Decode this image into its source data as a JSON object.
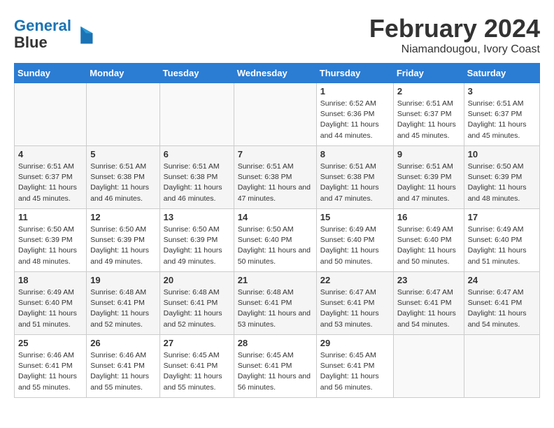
{
  "header": {
    "logo_line1": "General",
    "logo_line2": "Blue",
    "month_title": "February 2024",
    "subtitle": "Niamandougou, Ivory Coast"
  },
  "days_of_week": [
    "Sunday",
    "Monday",
    "Tuesday",
    "Wednesday",
    "Thursday",
    "Friday",
    "Saturday"
  ],
  "weeks": [
    [
      {
        "day": "",
        "sunrise": "",
        "sunset": "",
        "daylight": "",
        "empty": true
      },
      {
        "day": "",
        "sunrise": "",
        "sunset": "",
        "daylight": "",
        "empty": true
      },
      {
        "day": "",
        "sunrise": "",
        "sunset": "",
        "daylight": "",
        "empty": true
      },
      {
        "day": "",
        "sunrise": "",
        "sunset": "",
        "daylight": "",
        "empty": true
      },
      {
        "day": "1",
        "sunrise": "Sunrise: 6:52 AM",
        "sunset": "Sunset: 6:36 PM",
        "daylight": "Daylight: 11 hours and 44 minutes.",
        "empty": false
      },
      {
        "day": "2",
        "sunrise": "Sunrise: 6:51 AM",
        "sunset": "Sunset: 6:37 PM",
        "daylight": "Daylight: 11 hours and 45 minutes.",
        "empty": false
      },
      {
        "day": "3",
        "sunrise": "Sunrise: 6:51 AM",
        "sunset": "Sunset: 6:37 PM",
        "daylight": "Daylight: 11 hours and 45 minutes.",
        "empty": false
      }
    ],
    [
      {
        "day": "4",
        "sunrise": "Sunrise: 6:51 AM",
        "sunset": "Sunset: 6:37 PM",
        "daylight": "Daylight: 11 hours and 45 minutes.",
        "empty": false
      },
      {
        "day": "5",
        "sunrise": "Sunrise: 6:51 AM",
        "sunset": "Sunset: 6:38 PM",
        "daylight": "Daylight: 11 hours and 46 minutes.",
        "empty": false
      },
      {
        "day": "6",
        "sunrise": "Sunrise: 6:51 AM",
        "sunset": "Sunset: 6:38 PM",
        "daylight": "Daylight: 11 hours and 46 minutes.",
        "empty": false
      },
      {
        "day": "7",
        "sunrise": "Sunrise: 6:51 AM",
        "sunset": "Sunset: 6:38 PM",
        "daylight": "Daylight: 11 hours and 47 minutes.",
        "empty": false
      },
      {
        "day": "8",
        "sunrise": "Sunrise: 6:51 AM",
        "sunset": "Sunset: 6:38 PM",
        "daylight": "Daylight: 11 hours and 47 minutes.",
        "empty": false
      },
      {
        "day": "9",
        "sunrise": "Sunrise: 6:51 AM",
        "sunset": "Sunset: 6:39 PM",
        "daylight": "Daylight: 11 hours and 47 minutes.",
        "empty": false
      },
      {
        "day": "10",
        "sunrise": "Sunrise: 6:50 AM",
        "sunset": "Sunset: 6:39 PM",
        "daylight": "Daylight: 11 hours and 48 minutes.",
        "empty": false
      }
    ],
    [
      {
        "day": "11",
        "sunrise": "Sunrise: 6:50 AM",
        "sunset": "Sunset: 6:39 PM",
        "daylight": "Daylight: 11 hours and 48 minutes.",
        "empty": false
      },
      {
        "day": "12",
        "sunrise": "Sunrise: 6:50 AM",
        "sunset": "Sunset: 6:39 PM",
        "daylight": "Daylight: 11 hours and 49 minutes.",
        "empty": false
      },
      {
        "day": "13",
        "sunrise": "Sunrise: 6:50 AM",
        "sunset": "Sunset: 6:39 PM",
        "daylight": "Daylight: 11 hours and 49 minutes.",
        "empty": false
      },
      {
        "day": "14",
        "sunrise": "Sunrise: 6:50 AM",
        "sunset": "Sunset: 6:40 PM",
        "daylight": "Daylight: 11 hours and 50 minutes.",
        "empty": false
      },
      {
        "day": "15",
        "sunrise": "Sunrise: 6:49 AM",
        "sunset": "Sunset: 6:40 PM",
        "daylight": "Daylight: 11 hours and 50 minutes.",
        "empty": false
      },
      {
        "day": "16",
        "sunrise": "Sunrise: 6:49 AM",
        "sunset": "Sunset: 6:40 PM",
        "daylight": "Daylight: 11 hours and 50 minutes.",
        "empty": false
      },
      {
        "day": "17",
        "sunrise": "Sunrise: 6:49 AM",
        "sunset": "Sunset: 6:40 PM",
        "daylight": "Daylight: 11 hours and 51 minutes.",
        "empty": false
      }
    ],
    [
      {
        "day": "18",
        "sunrise": "Sunrise: 6:49 AM",
        "sunset": "Sunset: 6:40 PM",
        "daylight": "Daylight: 11 hours and 51 minutes.",
        "empty": false
      },
      {
        "day": "19",
        "sunrise": "Sunrise: 6:48 AM",
        "sunset": "Sunset: 6:41 PM",
        "daylight": "Daylight: 11 hours and 52 minutes.",
        "empty": false
      },
      {
        "day": "20",
        "sunrise": "Sunrise: 6:48 AM",
        "sunset": "Sunset: 6:41 PM",
        "daylight": "Daylight: 11 hours and 52 minutes.",
        "empty": false
      },
      {
        "day": "21",
        "sunrise": "Sunrise: 6:48 AM",
        "sunset": "Sunset: 6:41 PM",
        "daylight": "Daylight: 11 hours and 53 minutes.",
        "empty": false
      },
      {
        "day": "22",
        "sunrise": "Sunrise: 6:47 AM",
        "sunset": "Sunset: 6:41 PM",
        "daylight": "Daylight: 11 hours and 53 minutes.",
        "empty": false
      },
      {
        "day": "23",
        "sunrise": "Sunrise: 6:47 AM",
        "sunset": "Sunset: 6:41 PM",
        "daylight": "Daylight: 11 hours and 54 minutes.",
        "empty": false
      },
      {
        "day": "24",
        "sunrise": "Sunrise: 6:47 AM",
        "sunset": "Sunset: 6:41 PM",
        "daylight": "Daylight: 11 hours and 54 minutes.",
        "empty": false
      }
    ],
    [
      {
        "day": "25",
        "sunrise": "Sunrise: 6:46 AM",
        "sunset": "Sunset: 6:41 PM",
        "daylight": "Daylight: 11 hours and 55 minutes.",
        "empty": false
      },
      {
        "day": "26",
        "sunrise": "Sunrise: 6:46 AM",
        "sunset": "Sunset: 6:41 PM",
        "daylight": "Daylight: 11 hours and 55 minutes.",
        "empty": false
      },
      {
        "day": "27",
        "sunrise": "Sunrise: 6:45 AM",
        "sunset": "Sunset: 6:41 PM",
        "daylight": "Daylight: 11 hours and 55 minutes.",
        "empty": false
      },
      {
        "day": "28",
        "sunrise": "Sunrise: 6:45 AM",
        "sunset": "Sunset: 6:41 PM",
        "daylight": "Daylight: 11 hours and 56 minutes.",
        "empty": false
      },
      {
        "day": "29",
        "sunrise": "Sunrise: 6:45 AM",
        "sunset": "Sunset: 6:41 PM",
        "daylight": "Daylight: 11 hours and 56 minutes.",
        "empty": false
      },
      {
        "day": "",
        "sunrise": "",
        "sunset": "",
        "daylight": "",
        "empty": true
      },
      {
        "day": "",
        "sunrise": "",
        "sunset": "",
        "daylight": "",
        "empty": true
      }
    ]
  ]
}
